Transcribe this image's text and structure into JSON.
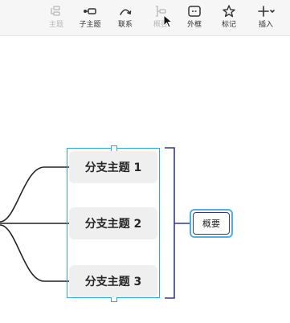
{
  "toolbar": {
    "items": [
      {
        "label": "主题",
        "icon": "topic-icon",
        "disabled": true
      },
      {
        "label": "子主题",
        "icon": "subtopic-icon",
        "disabled": false
      },
      {
        "label": "联系",
        "icon": "relationship-icon",
        "disabled": false
      },
      {
        "label": "概要",
        "icon": "summary-icon",
        "disabled": true
      },
      {
        "label": "外框",
        "icon": "boundary-icon",
        "disabled": false
      },
      {
        "label": "标记",
        "icon": "star-icon",
        "disabled": false
      },
      {
        "label": "插入",
        "icon": "plus-icon",
        "disabled": false
      }
    ],
    "colors": {
      "text": "#333333",
      "disabled": "#b8b8b8",
      "background": "#f6f6f6"
    }
  },
  "mindmap": {
    "topics": [
      "分支主题 1",
      "分支主题 2",
      "分支主题 3"
    ],
    "summary_label": "概要",
    "colors": {
      "selection": "#2ea8e5",
      "bracket": "#2e3b8c",
      "topic_fill": "#efefef",
      "connector": "#222222"
    }
  }
}
